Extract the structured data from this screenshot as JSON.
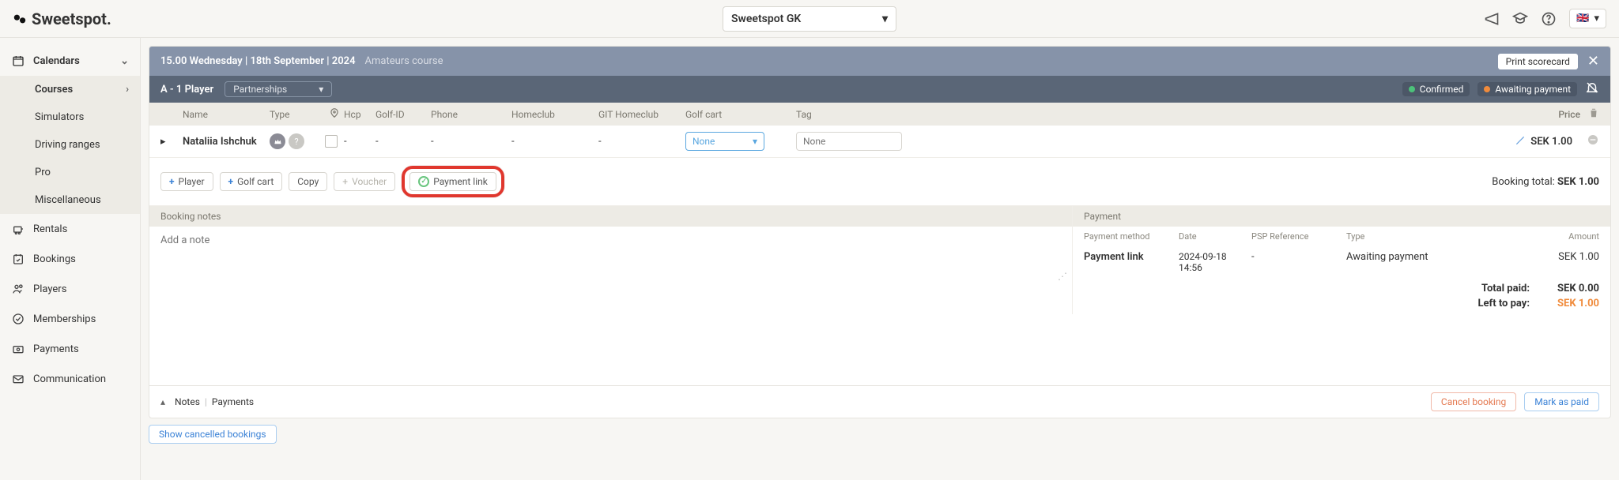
{
  "brand": "Sweetspot.",
  "club_dropdown": "Sweetspot GK",
  "language": "en-gb",
  "sidebar": {
    "calendars": "Calendars",
    "sub": [
      "Courses",
      "Simulators",
      "Driving ranges",
      "Pro",
      "Miscellaneous"
    ],
    "rentals": "Rentals",
    "bookings": "Bookings",
    "players": "Players",
    "memberships": "Memberships",
    "payments": "Payments",
    "communication": "Communication"
  },
  "panel": {
    "title": "15.00 Wednesday | 18th September | 2024",
    "course": "Amateurs course",
    "print": "Print scorecard",
    "slot": "A - 1 Player",
    "partnerships": "Partnerships",
    "status_confirmed": "Confirmed",
    "status_awaiting": "Awaiting payment"
  },
  "columns": {
    "name": "Name",
    "type": "Type",
    "hcp": "Hcp",
    "golfid": "Golf-ID",
    "phone": "Phone",
    "homeclub": "Homeclub",
    "githome": "GIT Homeclub",
    "cart": "Golf cart",
    "tag": "Tag",
    "price": "Price"
  },
  "row": {
    "name": "Nataliia Ishchuk",
    "hcp": "-",
    "golfid": "-",
    "phone": "-",
    "homeclub": "-",
    "githome": "-",
    "cart": "None",
    "tag_placeholder": "None",
    "price": "SEK 1.00"
  },
  "actions": {
    "player": "Player",
    "golfcart": "Golf cart",
    "copy": "Copy",
    "voucher": "Voucher",
    "payment_link": "Payment link",
    "booking_total_lbl": "Booking total:",
    "booking_total_val": "SEK 1.00"
  },
  "notes": {
    "label": "Booking notes",
    "placeholder": "Add a note"
  },
  "payment": {
    "label": "Payment",
    "cols": {
      "method": "Payment method",
      "date": "Date",
      "psp": "PSP Reference",
      "type": "Type",
      "amount": "Amount"
    },
    "row": {
      "method": "Payment link",
      "date": "2024-09-18 14:56",
      "psp": "-",
      "type": "Awaiting payment",
      "amount": "SEK 1.00"
    },
    "total_paid_lbl": "Total paid:",
    "total_paid_val": "SEK 0.00",
    "left_lbl": "Left to pay:",
    "left_val": "SEK 1.00"
  },
  "footer": {
    "notes": "Notes",
    "payments": "Payments",
    "cancel": "Cancel booking",
    "mark_paid": "Mark as paid",
    "show_cancelled": "Show cancelled bookings"
  }
}
